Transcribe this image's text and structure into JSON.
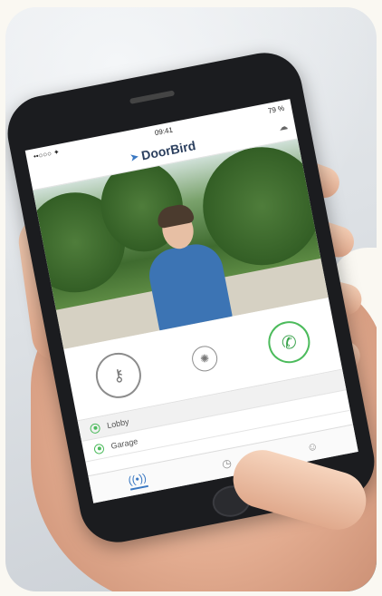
{
  "app": {
    "logo_text": "DoorBird",
    "logo_icon": "bird-logo-icon"
  },
  "status_bar": {
    "carrier": "••○○○ ✦",
    "time": "09:41",
    "battery": "79 %"
  },
  "header": {
    "cloud_icon": "cloud-icon"
  },
  "controls": {
    "door_icon": "key-icon",
    "door_glyph": "⚷",
    "light_icon": "bulb-icon",
    "light_glyph": "✺",
    "call_icon": "phone-icon",
    "call_glyph": "✆"
  },
  "list": {
    "items": [
      {
        "label": "Lobby"
      },
      {
        "label": "Garage"
      }
    ]
  },
  "tab_bar": {
    "tabs": [
      {
        "icon": "radio-waves-icon",
        "glyph": "((•))"
      },
      {
        "icon": "history-icon",
        "glyph": "◷"
      },
      {
        "icon": "settings-icon",
        "glyph": "☺"
      }
    ]
  },
  "colors": {
    "accent_green": "#4cbb5c",
    "accent_blue": "#3a78c2",
    "brand_navy": "#2b3f5e"
  }
}
